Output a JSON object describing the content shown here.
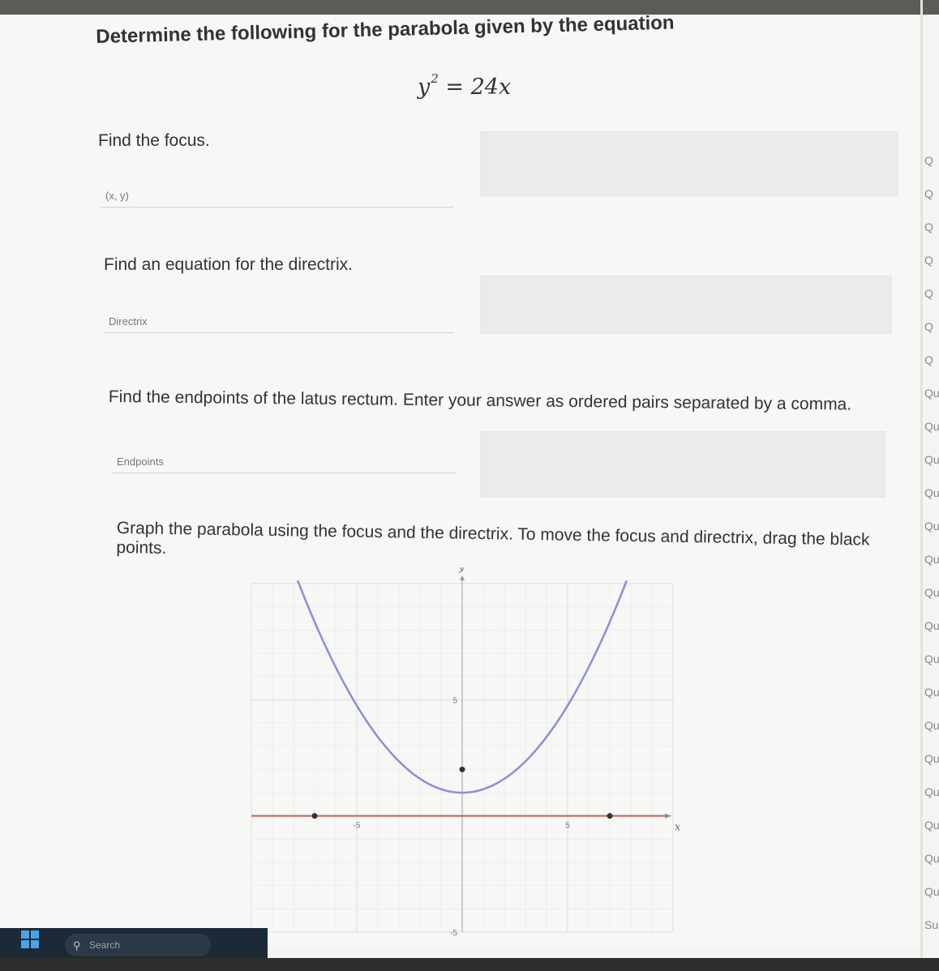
{
  "question": {
    "heading": "Determine the following for the parabola given by the equation",
    "equation_lhs": "y",
    "equation_exp": "2",
    "equation_rhs": "= 24x"
  },
  "parts": {
    "focus": {
      "prompt": "Find the focus.",
      "placeholder": "(x, y)"
    },
    "directrix": {
      "prompt": "Find an equation for the directrix.",
      "placeholder": "Directrix"
    },
    "latus": {
      "prompt": "Find the endpoints of the latus rectum. Enter your answer as ordered pairs separated by a comma.",
      "placeholder": "Endpoints"
    },
    "graph": {
      "prompt": "Graph the parabola using the focus and the directrix. To move the focus and directrix, drag the black points."
    }
  },
  "chart_data": {
    "type": "line",
    "xlabel": "x",
    "ylabel": "y",
    "xlim": [
      -10,
      10
    ],
    "ylim": [
      -5,
      10
    ],
    "x_ticks": [
      {
        "value": -5,
        "label": "-5"
      },
      {
        "value": 5,
        "label": "5"
      }
    ],
    "y_ticks": [
      {
        "value": 5,
        "label": "5"
      },
      {
        "value": -5,
        "label": "-5"
      }
    ],
    "grid": true,
    "parabola": {
      "vertex": [
        0,
        1
      ],
      "a": 0.15
    },
    "focus_point": [
      0,
      2
    ],
    "directrix": {
      "y": 0,
      "handles": [
        -7,
        7
      ]
    },
    "curve_color": "#8a8fd8",
    "directrix_color": "#c26060"
  },
  "rail": {
    "items": [
      "Q",
      "Q",
      "Q",
      "Q",
      "Q",
      "Q",
      "Q",
      "Qu",
      "Qu",
      "Qu",
      "Qu",
      "Que",
      "Que",
      "Que",
      "Que",
      "Ques",
      "Ques",
      "Ques",
      "Ques",
      "Quest",
      "Quest",
      "Quest",
      "Questi",
      "Submit"
    ]
  },
  "taskbar": {
    "search_placeholder": "Search"
  }
}
